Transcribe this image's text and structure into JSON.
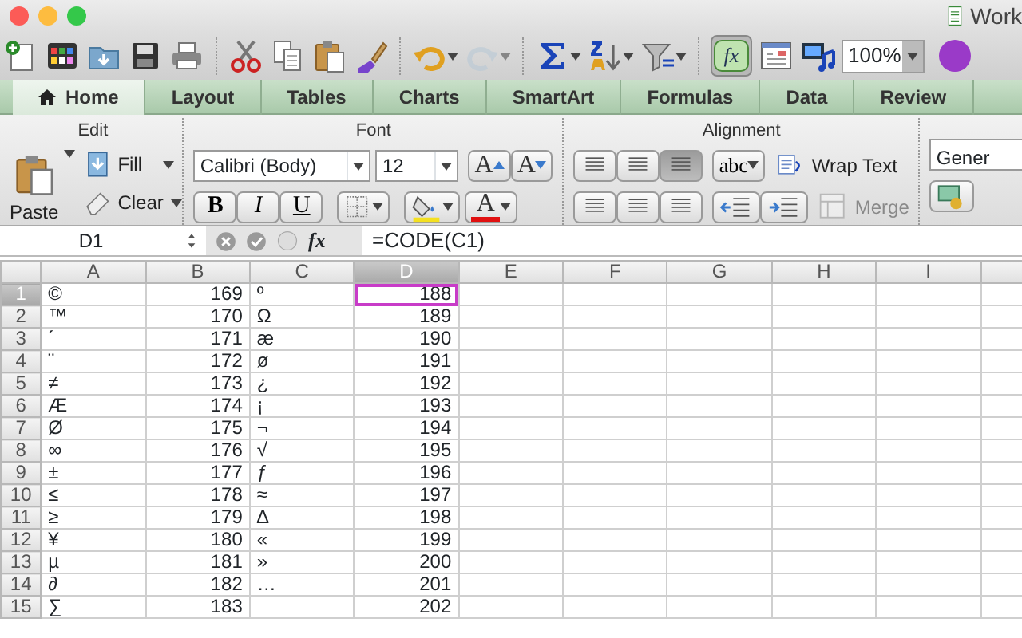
{
  "window": {
    "title": "Work"
  },
  "toolbar": {
    "formula_builder_on": true,
    "formula_builder_label": "fx",
    "redo_disabled": true,
    "zoom": "100%"
  },
  "tabs": [
    {
      "label": "Home",
      "selected": true
    },
    {
      "label": "Layout",
      "selected": false
    },
    {
      "label": "Tables",
      "selected": false
    },
    {
      "label": "Charts",
      "selected": false
    },
    {
      "label": "SmartArt",
      "selected": false
    },
    {
      "label": "Formulas",
      "selected": false
    },
    {
      "label": "Data",
      "selected": false
    },
    {
      "label": "Review",
      "selected": false
    }
  ],
  "ribbon": {
    "groups": [
      "Edit",
      "Font",
      "Alignment"
    ],
    "paste": "Paste",
    "fill": "Fill",
    "clear": "Clear",
    "font_name": "Calibri (Body)",
    "font_size": "12",
    "grow_font": "A",
    "shrink_font": "A",
    "font_color": "A",
    "bold": "B",
    "italic": "I",
    "underline": "U",
    "orientation": "abc",
    "vertical_align": [
      {
        "selected": false
      },
      {
        "selected": false
      },
      {
        "selected": true
      }
    ],
    "wrap_text": "Wrap Text",
    "merge": "Merge",
    "merge_disabled": true,
    "number_format": "Gener"
  },
  "formula_bar": {
    "name_box": "D1",
    "insert_function": "fx",
    "formula": "=CODE(C1)"
  },
  "sheet": {
    "columns": [
      {
        "label": "A",
        "selected": false
      },
      {
        "label": "B",
        "selected": false
      },
      {
        "label": "C",
        "selected": false
      },
      {
        "label": "D",
        "selected": true
      },
      {
        "label": "E",
        "selected": false
      },
      {
        "label": "F",
        "selected": false
      },
      {
        "label": "G",
        "selected": false
      },
      {
        "label": "H",
        "selected": false
      },
      {
        "label": "I",
        "selected": false
      }
    ],
    "rows": [
      {
        "header": "1",
        "selected": true,
        "cells": [
          "©",
          "169",
          "º",
          "188"
        ]
      },
      {
        "header": "2",
        "selected": false,
        "cells": [
          "™",
          "170",
          "Ω",
          "189"
        ]
      },
      {
        "header": "3",
        "selected": false,
        "cells": [
          "´",
          "171",
          "æ",
          "190"
        ]
      },
      {
        "header": "4",
        "selected": false,
        "cells": [
          "¨",
          "172",
          "ø",
          "191"
        ]
      },
      {
        "header": "5",
        "selected": false,
        "cells": [
          "≠",
          "173",
          "¿",
          "192"
        ]
      },
      {
        "header": "6",
        "selected": false,
        "cells": [
          "Æ",
          "174",
          "¡",
          "193"
        ]
      },
      {
        "header": "7",
        "selected": false,
        "cells": [
          "Ø",
          "175",
          "¬",
          "194"
        ]
      },
      {
        "header": "8",
        "selected": false,
        "cells": [
          "∞",
          "176",
          "√",
          "195"
        ]
      },
      {
        "header": "9",
        "selected": false,
        "cells": [
          "±",
          "177",
          "ƒ",
          "196"
        ]
      },
      {
        "header": "10",
        "selected": false,
        "cells": [
          "≤",
          "178",
          "≈",
          "197"
        ]
      },
      {
        "header": "11",
        "selected": false,
        "cells": [
          "≥",
          "179",
          "∆",
          "198"
        ]
      },
      {
        "header": "12",
        "selected": false,
        "cells": [
          "¥",
          "180",
          "«",
          "199"
        ]
      },
      {
        "header": "13",
        "selected": false,
        "cells": [
          "µ",
          "181",
          "»",
          "200"
        ]
      },
      {
        "header": "14",
        "selected": false,
        "cells": [
          "∂",
          "182",
          "…",
          "201"
        ]
      },
      {
        "header": "15",
        "selected": false,
        "cells": [
          "∑",
          "183",
          null,
          "202"
        ]
      }
    ]
  }
}
